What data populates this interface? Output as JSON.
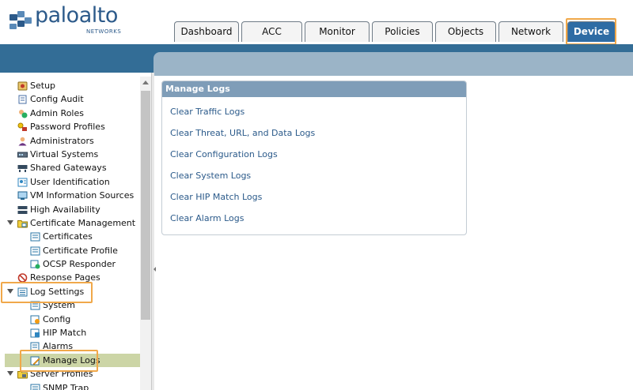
{
  "brand": {
    "name": "paloalto",
    "sub": "NETWORKS"
  },
  "tabs": [
    {
      "label": "Dashboard"
    },
    {
      "label": "ACC"
    },
    {
      "label": "Monitor"
    },
    {
      "label": "Policies"
    },
    {
      "label": "Objects"
    },
    {
      "label": "Network"
    },
    {
      "label": "Device"
    }
  ],
  "active_tab": "Device",
  "sidebar": {
    "items": [
      {
        "label": "Setup",
        "icon": "setup-icon"
      },
      {
        "label": "Config Audit",
        "icon": "config-audit-icon"
      },
      {
        "label": "Admin Roles",
        "icon": "admin-roles-icon"
      },
      {
        "label": "Password Profiles",
        "icon": "password-profiles-icon"
      },
      {
        "label": "Administrators",
        "icon": "administrators-icon"
      },
      {
        "label": "Virtual Systems",
        "icon": "virtual-systems-icon"
      },
      {
        "label": "Shared Gateways",
        "icon": "shared-gateways-icon"
      },
      {
        "label": "User Identification",
        "icon": "user-identification-icon"
      },
      {
        "label": "VM Information Sources",
        "icon": "vm-info-icon"
      },
      {
        "label": "High Availability",
        "icon": "high-availability-icon"
      },
      {
        "label": "Certificate Management",
        "icon": "certificate-management-icon"
      },
      {
        "label": "Certificates",
        "icon": "certificates-icon"
      },
      {
        "label": "Certificate Profile",
        "icon": "certificate-profile-icon"
      },
      {
        "label": "OCSP Responder",
        "icon": "ocsp-responder-icon"
      },
      {
        "label": "Response Pages",
        "icon": "response-pages-icon"
      },
      {
        "label": "Log Settings",
        "icon": "log-settings-icon"
      },
      {
        "label": "System",
        "icon": "system-icon"
      },
      {
        "label": "Config",
        "icon": "config-icon"
      },
      {
        "label": "HIP Match",
        "icon": "hip-match-icon"
      },
      {
        "label": "Alarms",
        "icon": "alarms-icon"
      },
      {
        "label": "Manage Logs",
        "icon": "manage-logs-icon"
      },
      {
        "label": "Server Profiles",
        "icon": "server-profiles-icon"
      },
      {
        "label": "SNMP Trap",
        "icon": "snmp-trap-icon"
      }
    ],
    "selected": "Manage Logs"
  },
  "panel": {
    "title": "Manage Logs",
    "links": [
      "Clear Traffic Logs",
      "Clear Threat, URL, and Data Logs",
      "Clear Configuration Logs",
      "Clear System Logs",
      "Clear HIP Match Logs",
      "Clear Alarm Logs"
    ]
  },
  "colors": {
    "brand": "#2c5a8a",
    "active_tab": "#2e6ca4",
    "band": "#336d96",
    "panel_header": "#7f9db8",
    "link": "#2b5a8a",
    "highlight": "#f0a84a",
    "selected_row": "#ccd5a6"
  }
}
